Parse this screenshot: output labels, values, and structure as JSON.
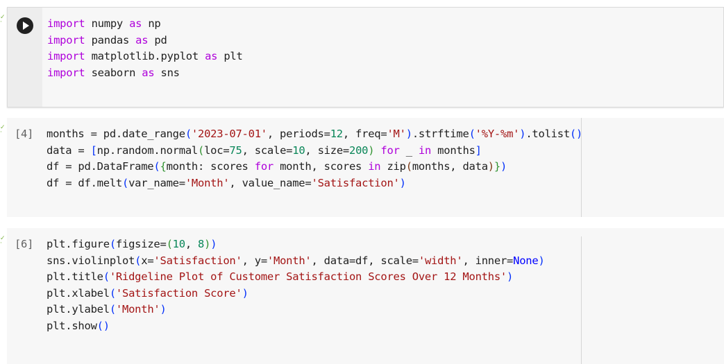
{
  "cells": [
    {
      "execution_count": "",
      "lines": [
        [
          {
            "t": "import",
            "c": "kw"
          },
          {
            "t": " numpy "
          },
          {
            "t": "as",
            "c": "kw"
          },
          {
            "t": " np"
          }
        ],
        [
          {
            "t": "import",
            "c": "kw"
          },
          {
            "t": " pandas "
          },
          {
            "t": "as",
            "c": "kw"
          },
          {
            "t": " pd"
          }
        ],
        [
          {
            "t": "import",
            "c": "kw"
          },
          {
            "t": " matplotlib.pyplot "
          },
          {
            "t": "as",
            "c": "kw"
          },
          {
            "t": " plt"
          }
        ],
        [
          {
            "t": "import",
            "c": "kw"
          },
          {
            "t": " seaborn "
          },
          {
            "t": "as",
            "c": "kw"
          },
          {
            "t": " sns"
          }
        ]
      ]
    },
    {
      "execution_count": "[4]",
      "lines": [
        [
          {
            "t": "months = pd.date_range"
          },
          {
            "t": "(",
            "c": "b1"
          },
          {
            "t": "'2023-07-01'",
            "c": "str"
          },
          {
            "t": ", periods="
          },
          {
            "t": "12",
            "c": "num"
          },
          {
            "t": ", freq="
          },
          {
            "t": "'M'",
            "c": "str"
          },
          {
            "t": ")",
            "c": "b1"
          },
          {
            "t": ".strftime"
          },
          {
            "t": "(",
            "c": "b1"
          },
          {
            "t": "'%Y-%m'",
            "c": "str"
          },
          {
            "t": ")",
            "c": "b1"
          },
          {
            "t": ".tolist"
          },
          {
            "t": "()",
            "c": "b1"
          }
        ],
        [
          {
            "t": "data = "
          },
          {
            "t": "[",
            "c": "b1"
          },
          {
            "t": "np.random.normal"
          },
          {
            "t": "(",
            "c": "b2"
          },
          {
            "t": "loc="
          },
          {
            "t": "75",
            "c": "num"
          },
          {
            "t": ", scale="
          },
          {
            "t": "10",
            "c": "num"
          },
          {
            "t": ", size="
          },
          {
            "t": "200",
            "c": "num"
          },
          {
            "t": ")",
            "c": "b2"
          },
          {
            "t": " "
          },
          {
            "t": "for",
            "c": "kw"
          },
          {
            "t": " _ "
          },
          {
            "t": "in",
            "c": "kw"
          },
          {
            "t": " months"
          },
          {
            "t": "]",
            "c": "b1"
          }
        ],
        [
          {
            "t": "df = pd.DataFrame"
          },
          {
            "t": "(",
            "c": "b1"
          },
          {
            "t": "{",
            "c": "b2"
          },
          {
            "t": "month: scores "
          },
          {
            "t": "for",
            "c": "kw"
          },
          {
            "t": " month, scores "
          },
          {
            "t": "in",
            "c": "kw"
          },
          {
            "t": " zip"
          },
          {
            "t": "(",
            "c": "b3"
          },
          {
            "t": "months, data"
          },
          {
            "t": ")",
            "c": "b3"
          },
          {
            "t": "}",
            "c": "b2"
          },
          {
            "t": ")",
            "c": "b1"
          }
        ],
        [
          {
            "t": "df = df.melt"
          },
          {
            "t": "(",
            "c": "b1"
          },
          {
            "t": "var_name="
          },
          {
            "t": "'Month'",
            "c": "str"
          },
          {
            "t": ", value_name="
          },
          {
            "t": "'Satisfaction'",
            "c": "str"
          },
          {
            "t": ")",
            "c": "b1"
          }
        ]
      ]
    },
    {
      "execution_count": "[6]",
      "lines": [
        [
          {
            "t": "plt.figure"
          },
          {
            "t": "(",
            "c": "b1"
          },
          {
            "t": "figsize="
          },
          {
            "t": "(",
            "c": "b2"
          },
          {
            "t": "10",
            "c": "num"
          },
          {
            "t": ", "
          },
          {
            "t": "8",
            "c": "num"
          },
          {
            "t": ")",
            "c": "b2"
          },
          {
            "t": ")",
            "c": "b1"
          }
        ],
        [
          {
            "t": "sns.violinplot"
          },
          {
            "t": "(",
            "c": "b1"
          },
          {
            "t": "x="
          },
          {
            "t": "'Satisfaction'",
            "c": "str"
          },
          {
            "t": ", y="
          },
          {
            "t": "'Month'",
            "c": "str"
          },
          {
            "t": ", data=df, scale="
          },
          {
            "t": "'width'",
            "c": "str"
          },
          {
            "t": ", inner="
          },
          {
            "t": "None",
            "c": "const"
          },
          {
            "t": ")",
            "c": "b1"
          }
        ],
        [
          {
            "t": "plt.title"
          },
          {
            "t": "(",
            "c": "b1"
          },
          {
            "t": "'Ridgeline Plot of Customer Satisfaction Scores Over 12 Months'",
            "c": "str"
          },
          {
            "t": ")",
            "c": "b1"
          }
        ],
        [
          {
            "t": "plt.xlabel"
          },
          {
            "t": "(",
            "c": "b1"
          },
          {
            "t": "'Satisfaction Score'",
            "c": "str"
          },
          {
            "t": ")",
            "c": "b1"
          }
        ],
        [
          {
            "t": "plt.ylabel"
          },
          {
            "t": "(",
            "c": "b1"
          },
          {
            "t": "'Month'",
            "c": "str"
          },
          {
            "t": ")",
            "c": "b1"
          }
        ],
        [
          {
            "t": "plt.show"
          },
          {
            "t": "()",
            "c": "b1"
          }
        ]
      ]
    }
  ]
}
